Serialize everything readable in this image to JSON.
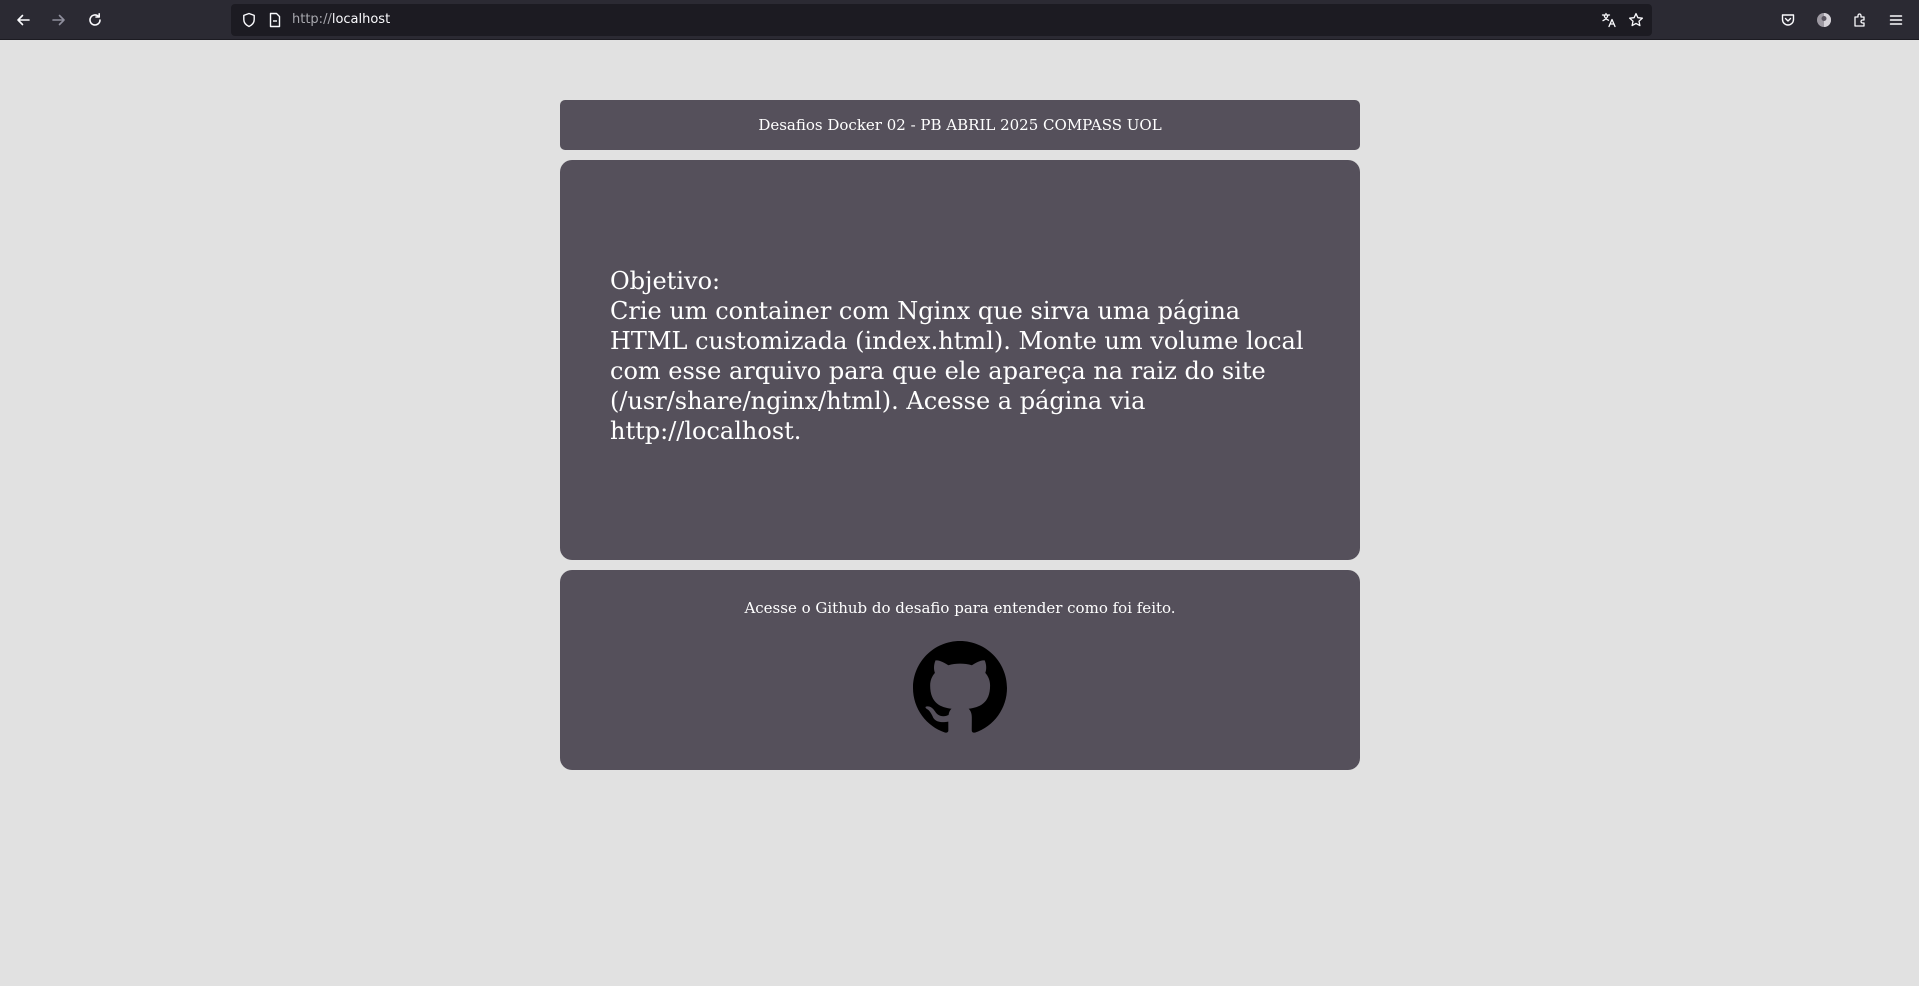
{
  "browser": {
    "address_bar": {
      "scheme": "http://",
      "host": "localhost"
    },
    "icons": {
      "back": "back-arrow-icon",
      "forward": "forward-arrow-icon",
      "reload": "reload-icon",
      "tracking_protection": "shield-icon",
      "page_info": "page-icon",
      "translate": "translate-icon",
      "bookmark": "star-icon",
      "pocket": "pocket-icon",
      "account": "account-icon",
      "extensions": "extensions-icon",
      "menu": "hamburger-menu-icon"
    },
    "colors": {
      "toolbar": "#2b2a33",
      "urlbar": "#1c1b22"
    }
  },
  "page": {
    "header": {
      "title": "Desafios Docker 02 - PB ABRIL 2025 COMPASS UOL"
    },
    "main": {
      "heading": "Objetivo:",
      "body": "Crie um container com Nginx que sirva uma página HTML customizada (index.html). Monte um volume local com esse arquivo para que ele apareça na raiz do site (/usr/share/nginx/html). Acesse a página via http://localhost."
    },
    "footer": {
      "text": "Acesse o Github do desafio para entender como foi feito.",
      "github_icon": "github-icon"
    },
    "colors": {
      "background": "#e1e1e1",
      "card": "#55505b",
      "text": "#ffffff"
    }
  }
}
